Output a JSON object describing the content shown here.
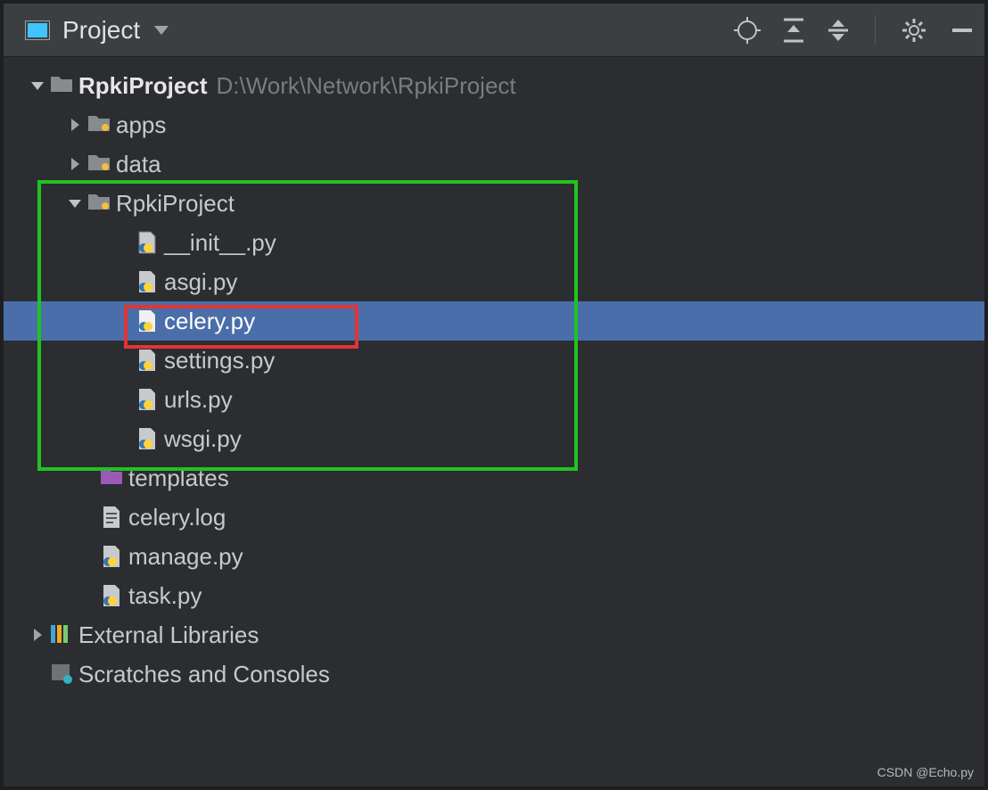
{
  "header": {
    "title": "Project"
  },
  "tree": {
    "root": {
      "name": "RpkiProject",
      "path": "D:\\Work\\Network\\RpkiProject",
      "children": [
        {
          "name": "apps",
          "type": "folder"
        },
        {
          "name": "data",
          "type": "folder"
        },
        {
          "name": "RpkiProject",
          "type": "folder",
          "expanded": true,
          "children": [
            {
              "name": "__init__.py",
              "type": "python"
            },
            {
              "name": "asgi.py",
              "type": "python"
            },
            {
              "name": "celery.py",
              "type": "python",
              "selected": true
            },
            {
              "name": "settings.py",
              "type": "python"
            },
            {
              "name": "urls.py",
              "type": "python"
            },
            {
              "name": "wsgi.py",
              "type": "python"
            }
          ]
        },
        {
          "name": "templates",
          "type": "templates"
        },
        {
          "name": "celery.log",
          "type": "text"
        },
        {
          "name": "manage.py",
          "type": "python"
        },
        {
          "name": "task.py",
          "type": "python"
        }
      ]
    },
    "extra": [
      {
        "name": "External Libraries",
        "type": "lib"
      },
      {
        "name": "Scratches and Consoles",
        "type": "scratch"
      }
    ]
  },
  "watermark": "CSDN @Echo.py"
}
